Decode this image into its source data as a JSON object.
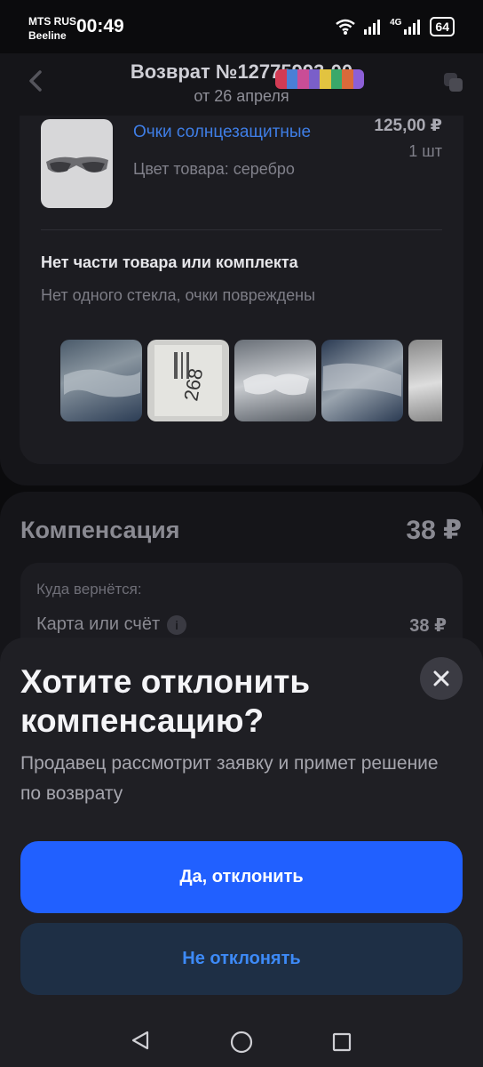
{
  "status_bar": {
    "carrier_1": "MTS RUS",
    "carrier_2": "Beeline",
    "time": "00:49",
    "battery": "64",
    "network": "4G"
  },
  "header": {
    "title": "Возврат №12775993-00",
    "subtitle": "от 26 апреля"
  },
  "product": {
    "name": "Очки солнцезащитные",
    "color": "Цвет товара: серебро",
    "price": "125,00 ₽",
    "quantity": "1 шт"
  },
  "reason": {
    "title": "Нет части товара или комплекта",
    "text": "Нет одного стекла, очки повреждены",
    "photo_note": "268"
  },
  "compensation": {
    "title": "Компенсация",
    "amount": "38 ₽",
    "destination_label": "Куда вернётся:",
    "destination": "Карта или счёт",
    "destination_amount": "38 ₽"
  },
  "dialog": {
    "title": "Хотите отклонить компенсацию?",
    "description": "Продавец рассмотрит заявку и примет решение по возврату",
    "confirm_label": "Да, отклонить",
    "cancel_label": "Не отклонять"
  },
  "colors": {
    "primary": "#2160ff",
    "secondary_bg": "#1e2f45",
    "secondary_text": "#3d8af7",
    "link": "#3f7ee6"
  }
}
